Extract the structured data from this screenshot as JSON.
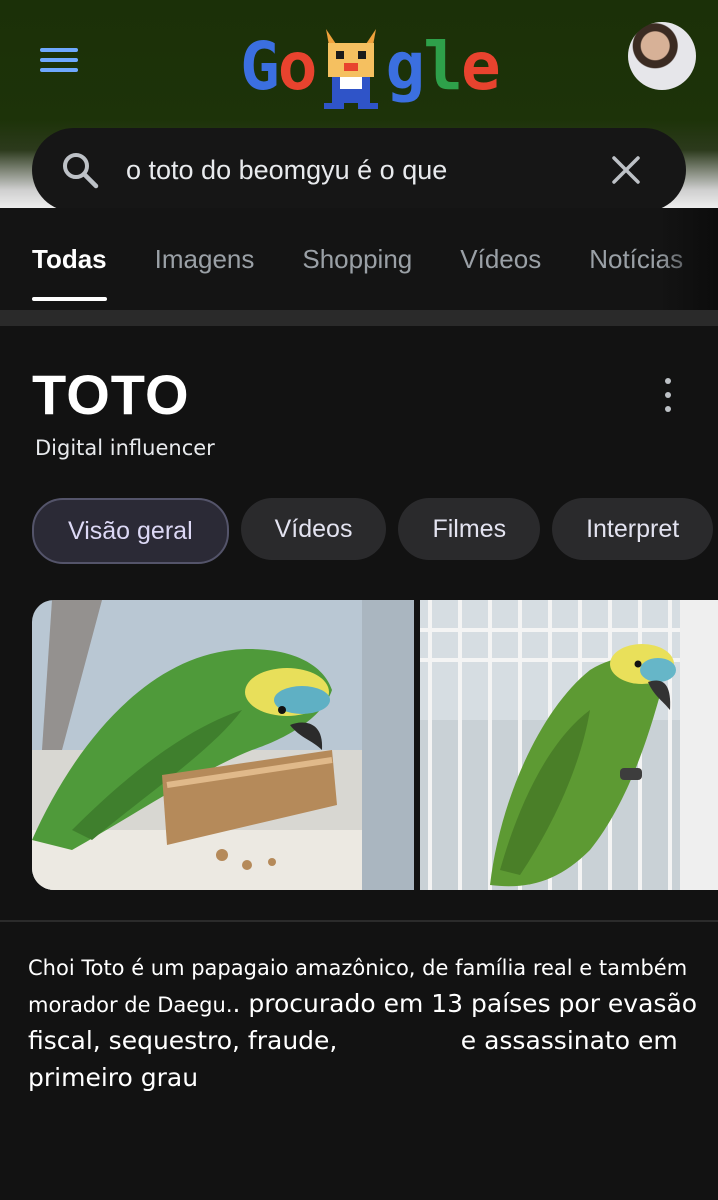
{
  "header": {
    "logo_text": "Google",
    "search": {
      "query": "o toto do beomgyu é o que"
    }
  },
  "tabs": [
    "Todas",
    "Imagens",
    "Shopping",
    "Vídeos",
    "Notícias"
  ],
  "entity": {
    "title": "TOTO",
    "subtitle": "Digital influencer",
    "chips": [
      "Visão geral",
      "Vídeos",
      "Filmes",
      "Interpret"
    ]
  },
  "description": {
    "part1": "Choi Toto é um papagaio amazônico, de família real e também morador de Daegu.",
    "part2": ". procurado em 13 países por evasão fiscal, sequestro, fraude,",
    "part3": "e assassinato em primeiro grau"
  },
  "colors": {
    "background": "#121212",
    "accent": "#6ea8fe"
  }
}
